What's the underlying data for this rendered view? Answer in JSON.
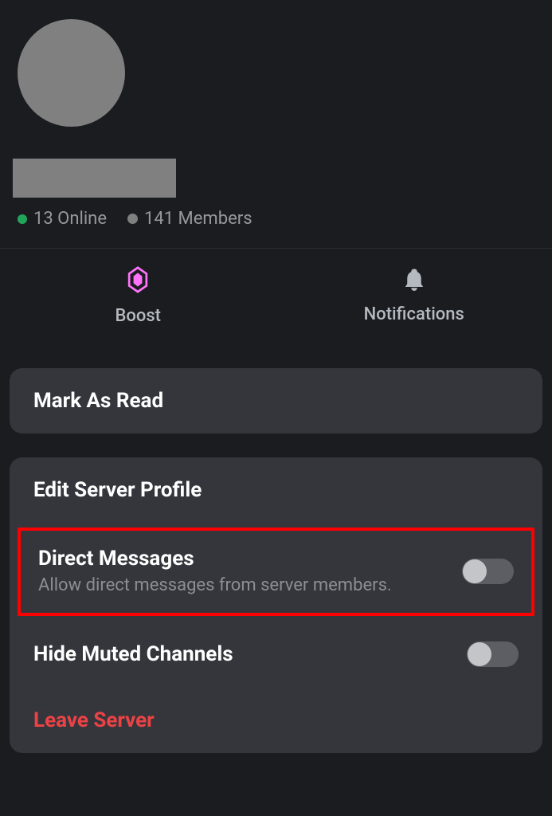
{
  "header": {
    "online_count": "13 Online",
    "members_count": "141 Members"
  },
  "actions": {
    "boost_label": "Boost",
    "notifications_label": "Notifications"
  },
  "menu": {
    "mark_as_read": "Mark As Read",
    "edit_profile": "Edit Server Profile",
    "direct_messages_title": "Direct Messages",
    "direct_messages_sub": "Allow direct messages from server members.",
    "hide_muted": "Hide Muted Channels",
    "leave_server": "Leave Server"
  }
}
